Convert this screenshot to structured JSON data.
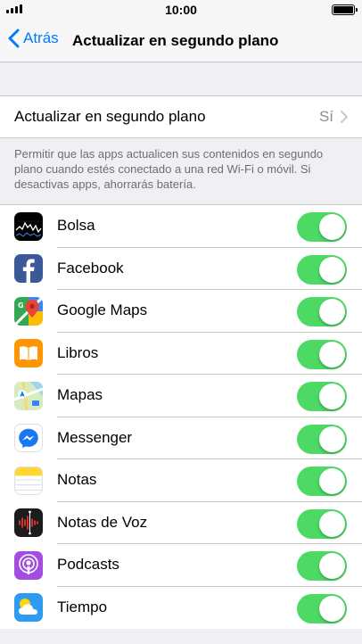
{
  "status_bar": {
    "time": "10:00",
    "signal_icon": "signal-bars-icon",
    "battery_icon": "battery-full-icon"
  },
  "nav": {
    "back_label": "Atrás",
    "title": "Actualizar en segundo plano"
  },
  "setting": {
    "label": "Actualizar en segundo plano",
    "value": "Sí"
  },
  "footer_text": "Permitir que las apps actualicen sus contenidos en segundo plano cuando estés conectado a una red Wi-Fi o móvil. Si desactivas apps, ahorrarás batería.",
  "apps": [
    {
      "name": "Bolsa",
      "icon": "stocks-icon",
      "enabled": true
    },
    {
      "name": "Facebook",
      "icon": "facebook-icon",
      "enabled": true
    },
    {
      "name": "Google Maps",
      "icon": "google-maps-icon",
      "enabled": true
    },
    {
      "name": "Libros",
      "icon": "books-icon",
      "enabled": true
    },
    {
      "name": "Mapas",
      "icon": "maps-icon",
      "enabled": true
    },
    {
      "name": "Messenger",
      "icon": "messenger-icon",
      "enabled": true
    },
    {
      "name": "Notas",
      "icon": "notes-icon",
      "enabled": true
    },
    {
      "name": "Notas de Voz",
      "icon": "voice-memos-icon",
      "enabled": true
    },
    {
      "name": "Podcasts",
      "icon": "podcasts-icon",
      "enabled": true
    },
    {
      "name": "Tiempo",
      "icon": "weather-icon",
      "enabled": true
    }
  ],
  "colors": {
    "accent": "#007aff",
    "toggle_on": "#4cd964",
    "background": "#efeff4"
  }
}
